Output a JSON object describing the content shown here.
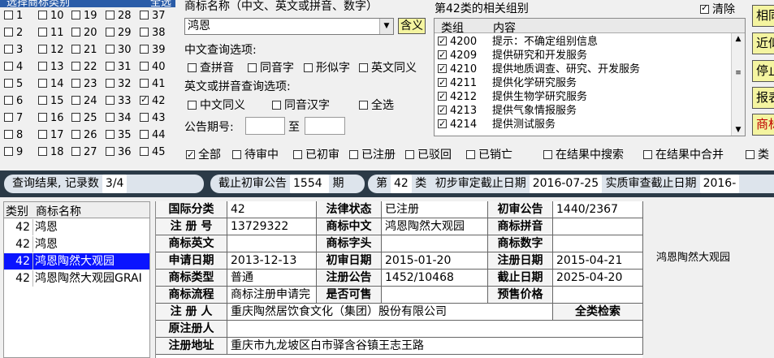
{
  "class_panel": {
    "title": "选择商标类别",
    "select_all": "全选",
    "rows": [
      [
        "1",
        "10",
        "19",
        "28",
        "37"
      ],
      [
        "2",
        "11",
        "20",
        "29",
        "38"
      ],
      [
        "3",
        "12",
        "21",
        "30",
        "39"
      ],
      [
        "4",
        "13",
        "22",
        "31",
        "40"
      ],
      [
        "5",
        "14",
        "23",
        "32",
        "41"
      ],
      [
        "6",
        "15",
        "24",
        "33",
        "42"
      ],
      [
        "7",
        "16",
        "25",
        "34",
        "43"
      ],
      [
        "8",
        "17",
        "26",
        "35",
        "44"
      ],
      [
        "9",
        "18",
        "27",
        "36",
        "45"
      ]
    ],
    "checked": [
      "42"
    ]
  },
  "search": {
    "name_label": "商标名称（中文、英文或拼音、数字）",
    "name_value": "鸿恩",
    "contain_button": "含义",
    "cn_options_label": "中文查询选项:",
    "cn_options": [
      "查拼音",
      "同音字",
      "形似字",
      "英文同义"
    ],
    "en_options_label": "英文或拼音查询选项:",
    "en_options": [
      "中文同义",
      "同音汉字",
      "全选"
    ],
    "period_label": "公告期号:",
    "period_to": "至"
  },
  "groups": {
    "title": "第42类的相关组别",
    "clear_label": "清除",
    "col_group": "类组",
    "col_content": "内容",
    "items": [
      {
        "code": "4200",
        "text": "提示：不确定组别信息"
      },
      {
        "code": "4209",
        "text": "提供研究和开发服务"
      },
      {
        "code": "4210",
        "text": "提供地质调查、研究、开发服务"
      },
      {
        "code": "4211",
        "text": "提供化学研究服务"
      },
      {
        "code": "4212",
        "text": "提供生物学研究服务"
      },
      {
        "code": "4213",
        "text": "提供气象情报服务"
      },
      {
        "code": "4214",
        "text": "提供测试服务"
      }
    ]
  },
  "right_buttons": [
    "相同",
    "近似",
    "停止",
    "报表",
    "商标"
  ],
  "filters": {
    "status": [
      "全部",
      "待审中",
      "已初审",
      "已注册",
      "已驳回",
      "已销亡"
    ],
    "search_in_results": "在结果中搜索",
    "merge_in_results": "在结果中合并",
    "extra": "类"
  },
  "info_bar": {
    "result_label": "查询结果, 记录数",
    "result_count": "3/4",
    "deadline_label": "截止初审公告",
    "deadline_value": "1554",
    "period_suffix": "期",
    "class_prefix": "第",
    "class_value": "42",
    "class_suffix": "类",
    "first_exam_label": "初步审定截止日期",
    "first_exam_date": "2016-07-25",
    "substantive_label": "实质审查截止日期",
    "substantive_date": "2016-"
  },
  "result_list": {
    "col_class": "类别",
    "col_name": "商标名称",
    "rows": [
      {
        "cls": "42",
        "name": "鸿恩"
      },
      {
        "cls": "42",
        "name": "鸿恩"
      },
      {
        "cls": "42",
        "name": "鸿恩陶然大观园"
      },
      {
        "cls": "42",
        "name": "鸿恩陶然大观园GRAI"
      }
    ],
    "selected_index": 2
  },
  "detail": {
    "intl_class_k": "国际分类",
    "intl_class_v": "42",
    "legal_status_k": "法律状态",
    "legal_status_v": "已注册",
    "first_pub_k": "初审公告",
    "first_pub_v": "1440/2367",
    "reg_no_k": "注 册 号",
    "reg_no_v": "13729322",
    "cn_name_k": "商标中文",
    "cn_name_v": "鸿恩陶然大观园",
    "pinyin_k": "商标拼音",
    "pinyin_v": "",
    "en_name_k": "商标英文",
    "en_name_v": "",
    "initial_k": "商标字头",
    "initial_v": "",
    "digits_k": "商标数字",
    "digits_v": "",
    "apply_date_k": "申请日期",
    "apply_date_v": "2013-12-13",
    "first_date_k": "初审日期",
    "first_date_v": "2015-01-20",
    "reg_date_k": "注册日期",
    "reg_date_v": "2015-04-21",
    "type_k": "商标类型",
    "type_v": "普通",
    "reg_pub_k": "注册公告",
    "reg_pub_v": "1452/10468",
    "expiry_k": "截止日期",
    "expiry_v": "2025-04-20",
    "flow_k": "商标流程",
    "flow_v": "商标注册申请完",
    "for_sale_k": "是否可售",
    "for_sale_v": "",
    "price_k": "预售价格",
    "price_v": "",
    "registrant_k": "注 册 人",
    "registrant_v": "重庆陶然居饮食文化（集团）股份有限公司",
    "full_search": "全类检索",
    "orig_registrant_k": "原注册人",
    "orig_registrant_v": "",
    "address_k": "注册地址",
    "address_v": "重庆市九龙坡区白市驿含谷镇王志王路"
  },
  "preview_text": "鸿恩陶然大观园"
}
